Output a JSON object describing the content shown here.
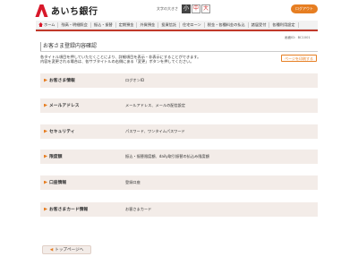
{
  "header": {
    "bank_name": "あいち銀行",
    "fontsize_label": "文字の大きさ",
    "fontsize_options": [
      "小",
      "中",
      "大"
    ],
    "fontsize_selected": 0,
    "logout_label": "ログアウト"
  },
  "nav": {
    "items": [
      "ホーム",
      "残高・明細照会",
      "振込・振替",
      "定期預金",
      "外貨預金",
      "投資信託",
      "住宅ローン",
      "税金・各種料金の払込",
      "諸届受付",
      "各種利用設定"
    ]
  },
  "screen_id": "画面ID：BC1001",
  "page_title": "お客さま登録内容確認",
  "description": {
    "line1": "各タイトル項目を押していただくことにより、詳細項目を表示・非表示にすることができます。",
    "line2": "内容を変更される場合は、各サブタイトルの右側にある「変更」ボタンを押してください。"
  },
  "print_button": "ページを印刷する",
  "sections": [
    {
      "title": "お客さま情報",
      "value": "ログオンID"
    },
    {
      "title": "メールアドレス",
      "value": "メールアドレス、メールの配信設定"
    },
    {
      "title": "セキュリティ",
      "value": "パスワード、ワンタイムパスワード"
    },
    {
      "title": "限度額",
      "value": "振込・振替限度額、daily取引振替の払込み限度額"
    },
    {
      "title": "口座情報",
      "value": "登録口座"
    },
    {
      "title": "お客さまカード情報",
      "value": "お客さまカード"
    }
  ],
  "top_button": "トップページへ"
}
